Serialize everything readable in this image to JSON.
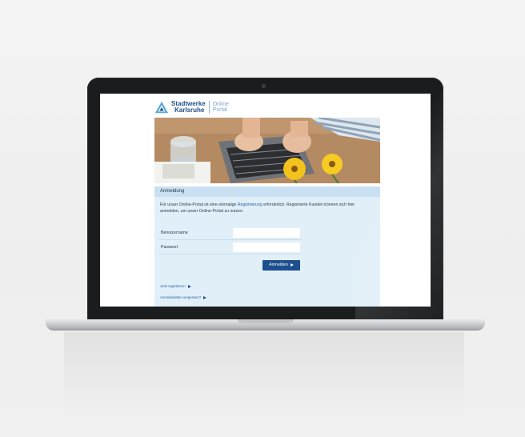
{
  "portal": {
    "brand_line1": "Stadtwerke",
    "brand_line2": "Karlsruhe",
    "portal_line1": "Online",
    "portal_line2": "Portal"
  },
  "login": {
    "heading": "Anmeldung",
    "intro_before": "Für unser Online-Portal ist eine einmalige ",
    "intro_link": "Registrierung",
    "intro_after": " erforderlich. Registrierte Kunden können sich hier anmelden, um unser Online-Portal zu nutzen.",
    "username_label": "Benutzername",
    "password_label": "Passwort",
    "submit_label": "Anmelden",
    "register_link": "Jetzt registrieren",
    "forgot_link": "Anmeldedaten vergessen?"
  },
  "colors": {
    "brand_blue": "#1d4f8e",
    "panel_bg": "#e1eff8",
    "panel_head": "#c9e1f2"
  }
}
